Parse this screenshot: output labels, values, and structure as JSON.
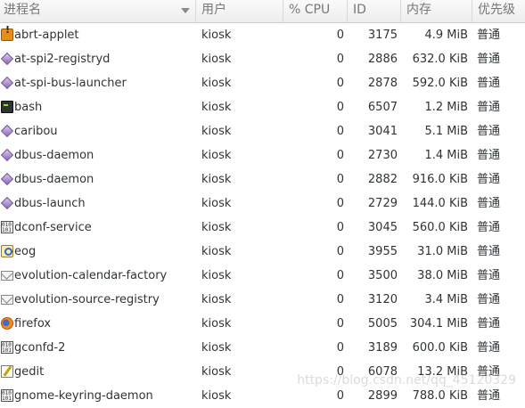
{
  "header": {
    "name": "进程名",
    "user": "用户",
    "cpu": "% CPU",
    "id": "ID",
    "memory": "内存",
    "priority": "优先级"
  },
  "processes": [
    {
      "name": "abrt-applet",
      "icon": "abrt-icon",
      "user": "kiosk",
      "cpu": "0",
      "id": "3175",
      "memory": "4.9 MiB",
      "priority": "普通"
    },
    {
      "name": "at-spi2-registryd",
      "icon": "generic-process-icon",
      "user": "kiosk",
      "cpu": "0",
      "id": "2886",
      "memory": "632.0 KiB",
      "priority": "普通"
    },
    {
      "name": "at-spi-bus-launcher",
      "icon": "generic-process-icon",
      "user": "kiosk",
      "cpu": "0",
      "id": "2878",
      "memory": "592.0 KiB",
      "priority": "普通"
    },
    {
      "name": "bash",
      "icon": "terminal-icon",
      "user": "kiosk",
      "cpu": "0",
      "id": "6507",
      "memory": "1.2 MiB",
      "priority": "普通"
    },
    {
      "name": "caribou",
      "icon": "generic-process-icon",
      "user": "kiosk",
      "cpu": "0",
      "id": "3041",
      "memory": "5.1 MiB",
      "priority": "普通"
    },
    {
      "name": "dbus-daemon",
      "icon": "generic-process-icon",
      "user": "kiosk",
      "cpu": "0",
      "id": "2730",
      "memory": "1.4 MiB",
      "priority": "普通"
    },
    {
      "name": "dbus-daemon",
      "icon": "generic-process-icon",
      "user": "kiosk",
      "cpu": "0",
      "id": "2882",
      "memory": "916.0 KiB",
      "priority": "普通"
    },
    {
      "name": "dbus-launch",
      "icon": "generic-process-icon",
      "user": "kiosk",
      "cpu": "0",
      "id": "2729",
      "memory": "144.0 KiB",
      "priority": "普通"
    },
    {
      "name": "dconf-service",
      "icon": "binary-icon",
      "user": "kiosk",
      "cpu": "0",
      "id": "3045",
      "memory": "560.0 KiB",
      "priority": "普通"
    },
    {
      "name": "eog",
      "icon": "image-viewer-icon",
      "user": "kiosk",
      "cpu": "0",
      "id": "3955",
      "memory": "31.0 MiB",
      "priority": "普通"
    },
    {
      "name": "evolution-calendar-factory",
      "icon": "mail-icon",
      "user": "kiosk",
      "cpu": "0",
      "id": "3500",
      "memory": "38.0 MiB",
      "priority": "普通"
    },
    {
      "name": "evolution-source-registry",
      "icon": "mail-icon",
      "user": "kiosk",
      "cpu": "0",
      "id": "3120",
      "memory": "3.4 MiB",
      "priority": "普通"
    },
    {
      "name": "firefox",
      "icon": "firefox-icon",
      "user": "kiosk",
      "cpu": "0",
      "id": "5005",
      "memory": "304.1 MiB",
      "priority": "普通"
    },
    {
      "name": "gconfd-2",
      "icon": "binary-icon",
      "user": "kiosk",
      "cpu": "0",
      "id": "3189",
      "memory": "600.0 KiB",
      "priority": "普通"
    },
    {
      "name": "gedit",
      "icon": "text-editor-icon",
      "user": "kiosk",
      "cpu": "0",
      "id": "6078",
      "memory": "13.2 MiB",
      "priority": "普通"
    },
    {
      "name": "gnome-keyring-daemon",
      "icon": "binary-icon",
      "user": "kiosk",
      "cpu": "0",
      "id": "2899",
      "memory": "788.0 KiB",
      "priority": "普通"
    }
  ],
  "watermark": "https://blog.csdn.net/qq_45120329"
}
